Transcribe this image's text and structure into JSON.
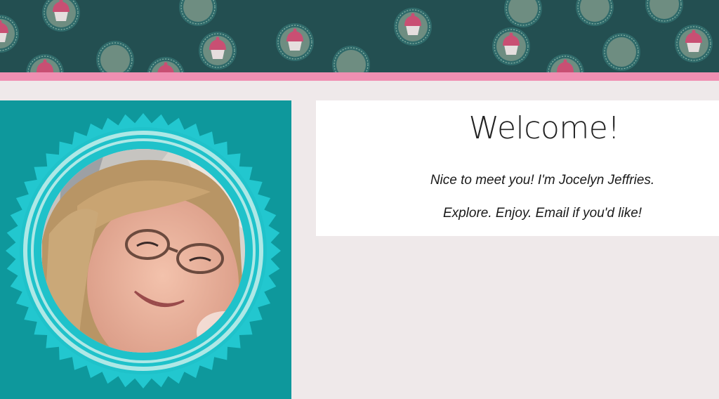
{
  "header": {
    "pattern_icon": "cupcake-icon",
    "background_color": "#234f51",
    "stripe_color": "#f08fb2"
  },
  "profile": {
    "photo_alt": "Portrait photo of Jocelyn Jeffries",
    "badge_color": "#22c7cf",
    "panel_color": "#0e989c"
  },
  "welcome": {
    "title": "Welcome!",
    "greeting": "Nice to meet you! I'm Jocelyn Jeffries.",
    "tagline": "Explore. Enjoy. Email if you'd like!"
  }
}
